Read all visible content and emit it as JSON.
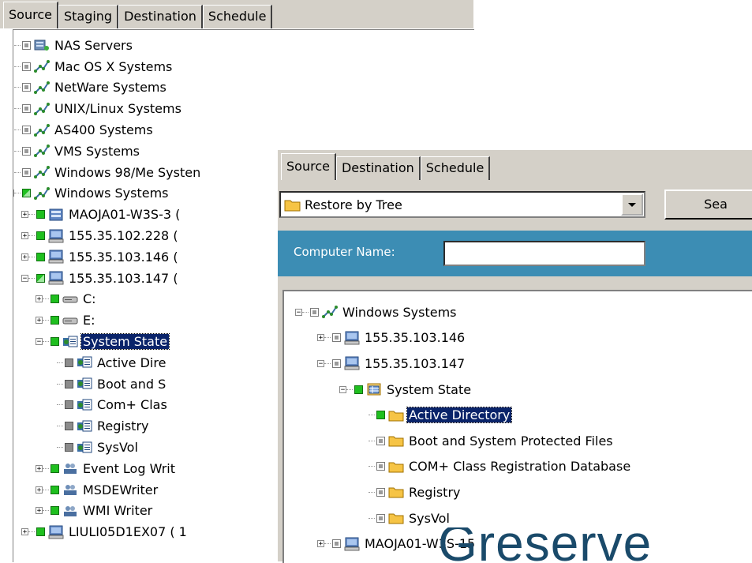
{
  "back_panel": {
    "tabs": [
      "Source",
      "Staging",
      "Destination",
      "Schedule"
    ],
    "active_tab": 0,
    "tree": [
      {
        "label": "NAS Servers",
        "icon": "nas-icon",
        "depth": 1,
        "state": "sm"
      },
      {
        "label": "Mac OS X Systems",
        "icon": "network-icon",
        "depth": 1,
        "state": "sm"
      },
      {
        "label": "NetWare Systems",
        "icon": "network-icon",
        "depth": 1,
        "state": "sm"
      },
      {
        "label": "UNIX/Linux Systems",
        "icon": "network-icon",
        "depth": 1,
        "state": "sm"
      },
      {
        "label": "AS400 Systems",
        "icon": "network-icon",
        "depth": 1,
        "state": "sm"
      },
      {
        "label": "VMS Systems",
        "icon": "network-icon",
        "depth": 1,
        "state": "sm"
      },
      {
        "label": "Windows 98/Me Systen",
        "icon": "network-icon",
        "depth": 1,
        "state": "sm"
      },
      {
        "label": "Windows Systems",
        "icon": "network-icon",
        "depth": 1,
        "state": "part",
        "expander": "-"
      },
      {
        "label": "MAOJA01-W3S-3 (",
        "icon": "server-icon",
        "depth": 2,
        "state": "on",
        "expander": "+"
      },
      {
        "label": "155.35.102.228 (",
        "icon": "computer-icon",
        "depth": 2,
        "state": "on",
        "expander": "+"
      },
      {
        "label": "155.35.103.146 (",
        "icon": "computer-icon",
        "depth": 2,
        "state": "on",
        "expander": "+"
      },
      {
        "label": "155.35.103.147 (",
        "icon": "computer-icon",
        "depth": 2,
        "state": "part",
        "expander": "-"
      },
      {
        "label": "C:",
        "icon": "drive-icon",
        "depth": 3,
        "state": "on",
        "expander": "+"
      },
      {
        "label": "E:",
        "icon": "drive-icon",
        "depth": 3,
        "state": "on",
        "expander": "+"
      },
      {
        "label": "System State",
        "icon": "system-state-icon",
        "depth": 3,
        "state": "full",
        "expander": "-",
        "selected": true
      },
      {
        "label": "Active Dire",
        "icon": "system-state-icon",
        "depth": 4,
        "state": "grey"
      },
      {
        "label": "Boot and S",
        "icon": "system-state-icon",
        "depth": 4,
        "state": "grey"
      },
      {
        "label": "Com+ Clas",
        "icon": "system-state-icon",
        "depth": 4,
        "state": "grey"
      },
      {
        "label": "Registry",
        "icon": "system-state-icon",
        "depth": 4,
        "state": "grey"
      },
      {
        "label": "SysVol",
        "icon": "system-state-icon",
        "depth": 4,
        "state": "grey"
      },
      {
        "label": "Event Log Writ",
        "icon": "writer-icon",
        "depth": 3,
        "state": "on",
        "expander": "+"
      },
      {
        "label": "MSDEWriter",
        "icon": "writer-icon",
        "depth": 3,
        "state": "on",
        "expander": "+"
      },
      {
        "label": "WMI Writer",
        "icon": "writer-icon",
        "depth": 3,
        "state": "on",
        "expander": "+"
      },
      {
        "label": "LIULI05D1EX07 ( 1",
        "icon": "computer-icon",
        "depth": 2,
        "state": "on",
        "expander": "+"
      }
    ]
  },
  "front_panel": {
    "tabs": [
      "Source",
      "Destination",
      "Schedule"
    ],
    "active_tab": 0,
    "restore_select": "Restore by Tree",
    "search_button": "Sea",
    "computer_name_label": "Computer Name:",
    "computer_name_value": "",
    "tree": [
      {
        "label": "Windows Systems",
        "icon": "network-icon",
        "depth": 0,
        "state": "sm",
        "expander": "-"
      },
      {
        "label": "155.35.103.146",
        "icon": "computer-icon",
        "depth": 1,
        "state": "sm",
        "expander": "+"
      },
      {
        "label": "155.35.103.147",
        "icon": "computer-icon",
        "depth": 1,
        "state": "sm",
        "expander": "-"
      },
      {
        "label": "System State",
        "icon": "system-state-db-icon",
        "depth": 2,
        "state": "on",
        "expander": "-"
      },
      {
        "label": "Active Directory",
        "icon": "folder-icon",
        "depth": 3,
        "state": "full",
        "selected": true
      },
      {
        "label": "Boot and System Protected Files",
        "icon": "folder-icon",
        "depth": 3,
        "state": "sm"
      },
      {
        "label": "COM+ Class Registration Database",
        "icon": "folder-icon",
        "depth": 3,
        "state": "sm"
      },
      {
        "label": "Registry",
        "icon": "folder-icon",
        "depth": 3,
        "state": "sm"
      },
      {
        "label": "SysVol",
        "icon": "folder-icon",
        "depth": 3,
        "state": "sm"
      },
      {
        "label": "MAOJA01-W3S-15",
        "icon": "computer-icon",
        "depth": 1,
        "state": "sm",
        "expander": "+"
      }
    ]
  },
  "watermark": "Greserve",
  "colors": {
    "bar_blue": "#3c8db4",
    "selection": "#0a246a",
    "check_green": "#1fbf1f",
    "watermark": "#1a4a6a"
  }
}
